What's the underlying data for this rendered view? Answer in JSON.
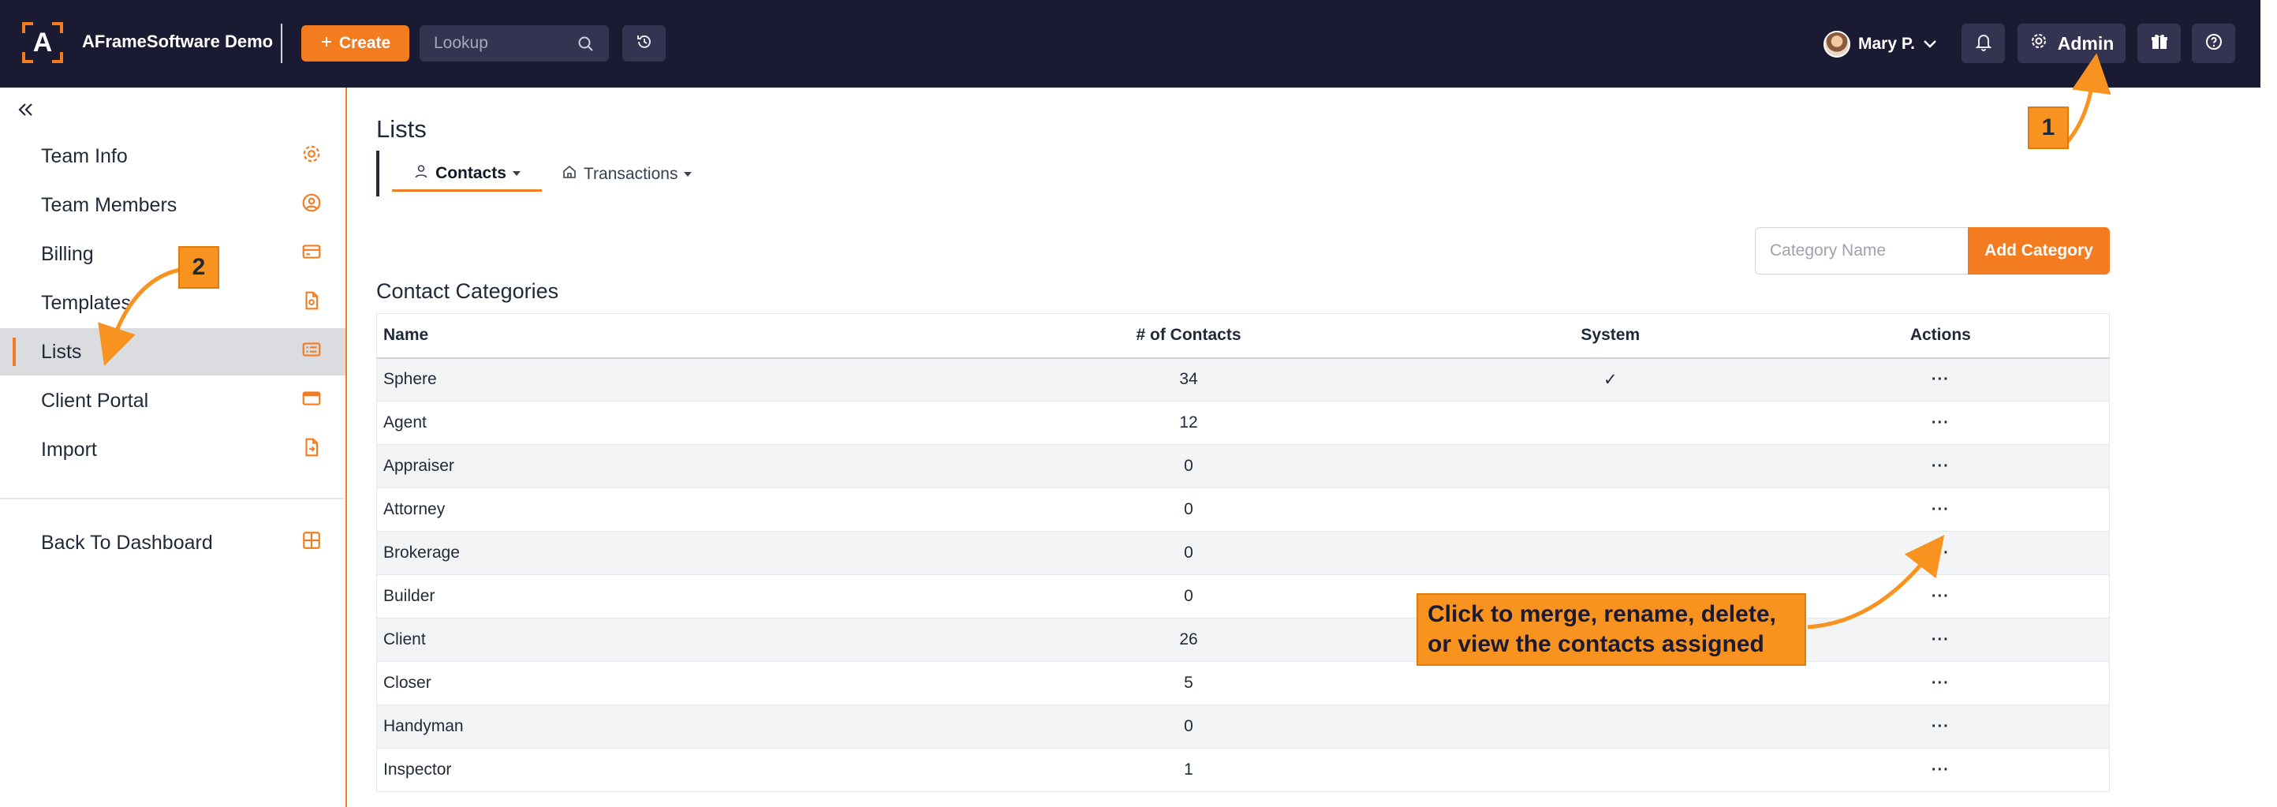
{
  "topbar": {
    "brand": "AFrameSoftware Demo",
    "logo_letter": "A",
    "create_label": "Create",
    "lookup_placeholder": "Lookup",
    "user_name": "Mary P.",
    "admin_label": "Admin"
  },
  "sidebar": {
    "items": [
      {
        "label": "Team Info",
        "icon": "gear-icon"
      },
      {
        "label": "Team Members",
        "icon": "user-circle-icon"
      },
      {
        "label": "Billing",
        "icon": "credit-card-icon"
      },
      {
        "label": "Templates",
        "icon": "document-icon"
      },
      {
        "label": "Lists",
        "icon": "list-icon"
      },
      {
        "label": "Client Portal",
        "icon": "portal-icon"
      },
      {
        "label": "Import",
        "icon": "import-icon"
      }
    ],
    "back_label": "Back To Dashboard",
    "active": "Lists"
  },
  "main": {
    "title": "Lists",
    "tabs": [
      {
        "label": "Contacts"
      },
      {
        "label": "Transactions"
      }
    ],
    "category_placeholder": "Category Name",
    "add_category_label": "Add Category",
    "section_title": "Contact Categories",
    "table": {
      "headers": [
        "Name",
        "# of Contacts",
        "System",
        "Actions"
      ],
      "rows": [
        {
          "name": "Sphere",
          "count": "34",
          "system": "✓",
          "actions": "···"
        },
        {
          "name": "Agent",
          "count": "12",
          "system": "",
          "actions": "···"
        },
        {
          "name": "Appraiser",
          "count": "0",
          "system": "",
          "actions": "···"
        },
        {
          "name": "Attorney",
          "count": "0",
          "system": "",
          "actions": "···"
        },
        {
          "name": "Brokerage",
          "count": "0",
          "system": "",
          "actions": "···"
        },
        {
          "name": "Builder",
          "count": "0",
          "system": "",
          "actions": "···"
        },
        {
          "name": "Client",
          "count": "26",
          "system": "",
          "actions": "···"
        },
        {
          "name": "Closer",
          "count": "5",
          "system": "",
          "actions": "···"
        },
        {
          "name": "Handyman",
          "count": "0",
          "system": "",
          "actions": "···"
        },
        {
          "name": "Inspector",
          "count": "1",
          "system": "",
          "actions": "···"
        }
      ]
    }
  },
  "annotations": {
    "badge1": "1",
    "badge2": "2",
    "callout_line1": "Click to merge, rename, delete,",
    "callout_line2": "or view the contacts assigned"
  },
  "colors": {
    "accent": "#f47c20",
    "topbar": "#1b1a33",
    "annotation": "#f7931e"
  }
}
